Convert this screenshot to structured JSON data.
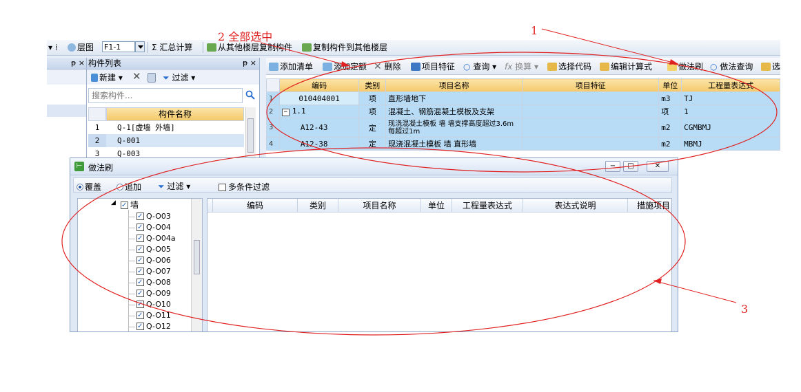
{
  "top_toolbar": {
    "layer_label": "层图",
    "layer_value": "F1-1",
    "sum_calc": "Σ 汇总计算",
    "copy_from_other": "从其他楼层复制构件",
    "copy_to_other": "复制构件到其他楼层"
  },
  "left_panel": {
    "pin": "ᵽ ×"
  },
  "component_list": {
    "title": "构件列表",
    "pin": "ᵽ ×",
    "new_label": "新建",
    "filter_label": "过滤",
    "search_placeholder": "搜索构件...",
    "column_header": "构件名称",
    "rows": [
      {
        "no": "1",
        "name": "Q-1[虚墙 外墙]"
      },
      {
        "no": "2",
        "name": "Q-001"
      },
      {
        "no": "3",
        "name": "Q-003"
      }
    ]
  },
  "right_toolbar": {
    "add_list": "添加清单",
    "add_quota": "添加定额",
    "delete": "删除",
    "item_feature": "项目特征",
    "query": "查询",
    "convert": "换算",
    "select_code": "选择代码",
    "edit_formula": "编辑计算式",
    "method_brush": "做法刷",
    "method_query": "做法查询",
    "select_more": "选"
  },
  "main_grid": {
    "headers": [
      "编码",
      "类别",
      "项目名称",
      "项目特征",
      "单位",
      "工程量表达式"
    ],
    "rows": [
      {
        "no": "1",
        "code": "010404001",
        "type": "项",
        "name": "直形墙地下",
        "feature": "",
        "unit": "m3",
        "expr": "TJ"
      },
      {
        "no": "2",
        "code": "1.1",
        "type": "项",
        "name": "混凝土、钢筋混凝土模板及支架",
        "feature": "",
        "unit": "项",
        "expr": "1"
      },
      {
        "no": "3",
        "code": "A12-43",
        "type": "定",
        "name": "现浇混凝土模板 墙 墙支撑高度超过3.6m每超过1m",
        "feature": "",
        "unit": "m2",
        "expr": "CGMBMJ"
      },
      {
        "no": "4",
        "code": "A12-38",
        "type": "定",
        "name": "现浇混凝土模板 墙 直形墙",
        "feature": "",
        "unit": "m2",
        "expr": "MBMJ"
      }
    ]
  },
  "dialog": {
    "title": "做法刷",
    "overwrite": "覆盖",
    "append": "追加",
    "filter": "过滤",
    "multi_filter": "多条件过滤",
    "tree_root": "墙",
    "tree_items": [
      "Q-O03",
      "Q-O04",
      "Q-O04a",
      "Q-O05",
      "Q-O06",
      "Q-O07",
      "Q-O08",
      "Q-O09",
      "Q-O10",
      "Q-O11",
      "Q-O12"
    ],
    "grid_headers": [
      "编码",
      "类别",
      "项目名称",
      "单位",
      "工程量表达式",
      "表达式说明",
      "措施项目"
    ]
  },
  "annotations": {
    "label_1": "1",
    "label_2": "2 全部选中",
    "label_3": "3"
  },
  "colors": {
    "annotation": "#e02020",
    "header_gold": "#f4c96a",
    "selection_blue": "#b9dcf6"
  }
}
